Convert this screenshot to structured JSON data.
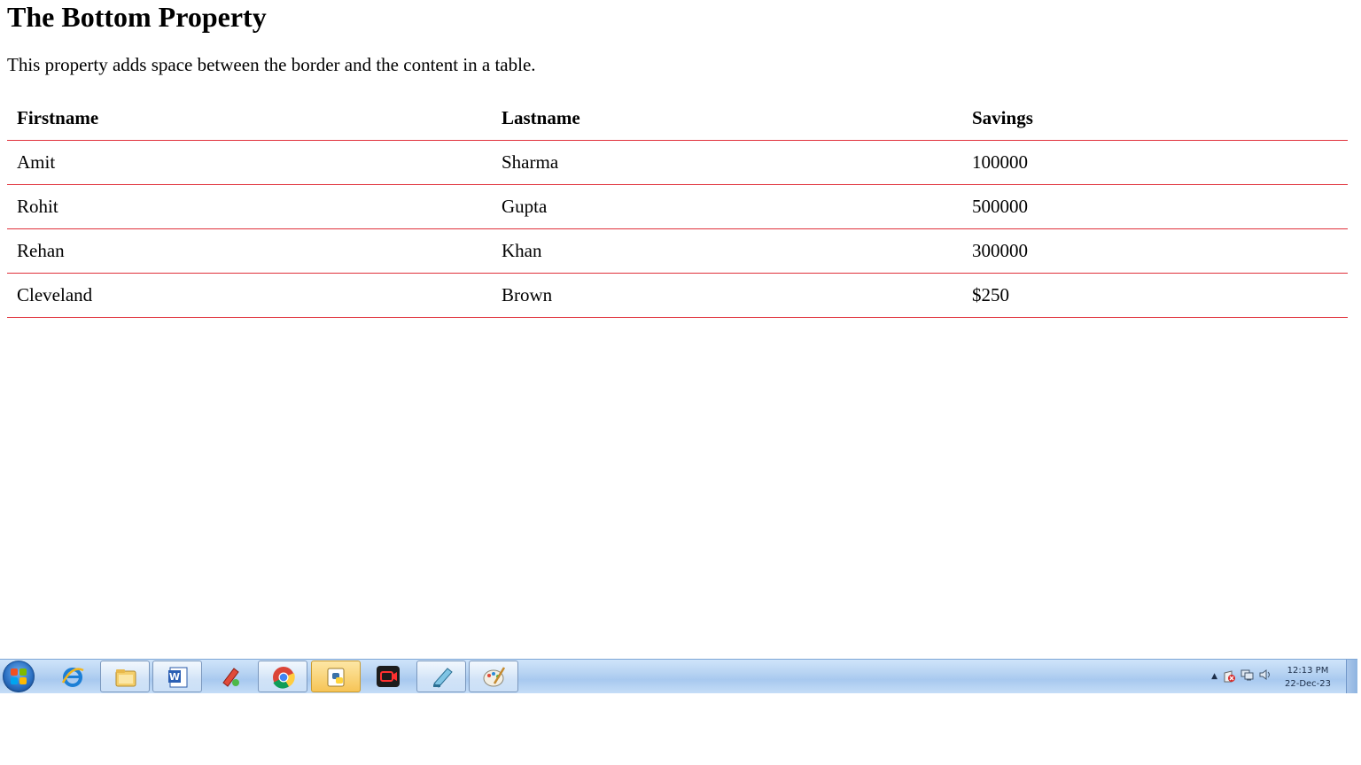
{
  "page": {
    "title": "The Bottom Property",
    "description": "This property adds space between the border and the content in a table."
  },
  "table": {
    "headers": [
      "Firstname",
      "Lastname",
      "Savings"
    ],
    "rows": [
      [
        "Amit",
        "Sharma",
        "100000"
      ],
      [
        "Rohit",
        "Gupta",
        "500000"
      ],
      [
        "Rehan",
        "Khan",
        "300000"
      ],
      [
        "Cleveland",
        "Brown",
        "$250"
      ]
    ],
    "border_color": "#e0303a"
  },
  "taskbar": {
    "apps": [
      "start-orb-icon",
      "internet-explorer-icon",
      "file-explorer-icon",
      "word-icon",
      "pencil-app-icon",
      "chrome-icon",
      "python-icon",
      "screen-recorder-icon",
      "notepad-app-icon",
      "paint-icon"
    ],
    "clock": {
      "time": "12:13 PM",
      "date": "22-Dec-23"
    }
  }
}
